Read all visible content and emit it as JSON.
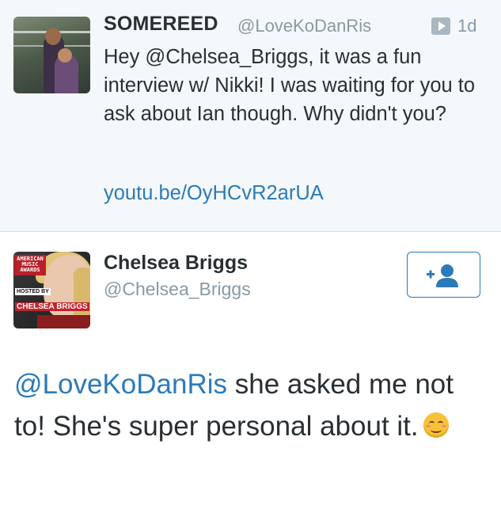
{
  "tweet1": {
    "display_name": "SOMEREED",
    "handle": "@LoveKoDanRis",
    "time": "1d",
    "text": "Hey @Chelsea_Briggs, it was a fun interview w/ Nikki! I was waiting for you to ask about Ian though. Why didn't you?",
    "link": "youtu.be/OyHCvR2arUA",
    "media_icon": "play-icon"
  },
  "tweet2": {
    "display_name": "Chelsea Briggs",
    "handle": "@Chelsea_Briggs",
    "follow_icon": "add-user-icon",
    "mention": "@LoveKoDanRis",
    "text": " she asked me not to! She's super personal about it.",
    "emoji": "smiling-face-icon",
    "avatar_text": {
      "logo": "AMERICAN MUSIC AWARDS",
      "hosted": "HOSTED BY",
      "host_name": "CHELSEA BRIGGS"
    }
  },
  "colors": {
    "link": "#2b7bb9",
    "text": "#292f33",
    "muted": "#8899a6",
    "tweet_bg": "#f5f8fa"
  }
}
